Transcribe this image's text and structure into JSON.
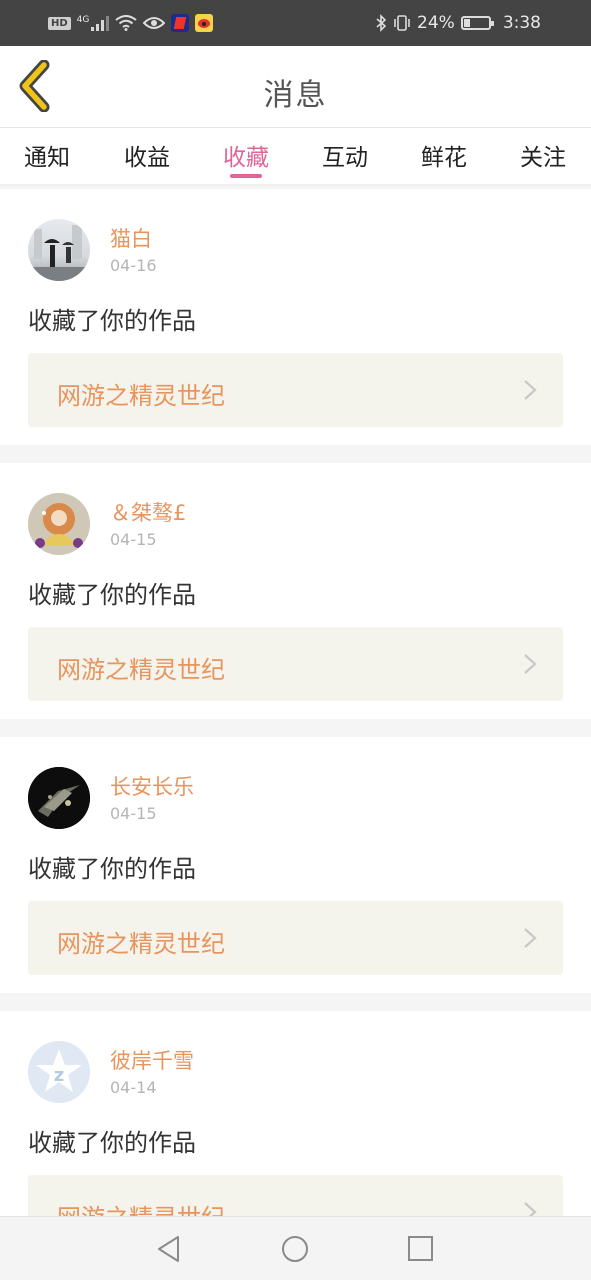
{
  "status_bar": {
    "hd_badge": "HD",
    "network": "4G",
    "battery": "24%",
    "battery_level": 0.24,
    "time": "3:38",
    "icons": [
      "hd-icon",
      "signal-4g-icon",
      "wifi-icon",
      "eye-icon",
      "app-icon",
      "weibo-icon",
      "bluetooth-icon",
      "vibrate-icon",
      "battery-icon"
    ]
  },
  "header": {
    "title": "消息",
    "back_icon": "chevron-left-icon",
    "back_color": "#f0c318"
  },
  "tabs": {
    "items": [
      {
        "label": "通知"
      },
      {
        "label": "收益"
      },
      {
        "label": "收藏"
      },
      {
        "label": "互动"
      },
      {
        "label": "鲜花"
      },
      {
        "label": "关注"
      }
    ],
    "active": "收藏",
    "active_color": "#e0669a"
  },
  "messages": [
    {
      "user": "猫白",
      "date": "04-16",
      "action": "收藏了你的作品",
      "work": "网游之精灵世纪"
    },
    {
      "user": "＆桀骜£",
      "date": "04-15",
      "action": "收藏了你的作品",
      "work": "网游之精灵世纪"
    },
    {
      "user": "长安长乐",
      "date": "04-15",
      "action": "收藏了你的作品",
      "work": "网游之精灵世纪"
    },
    {
      "user": "彼岸千雪",
      "date": "04-14",
      "action": "收藏了你的作品",
      "work": "网游之精灵世纪"
    }
  ],
  "colors": {
    "username": "#e8955d",
    "work_bg": "#f4f3ec"
  },
  "nav_bar": {
    "icons": [
      "nav-back-icon",
      "nav-home-icon",
      "nav-recents-icon"
    ]
  }
}
